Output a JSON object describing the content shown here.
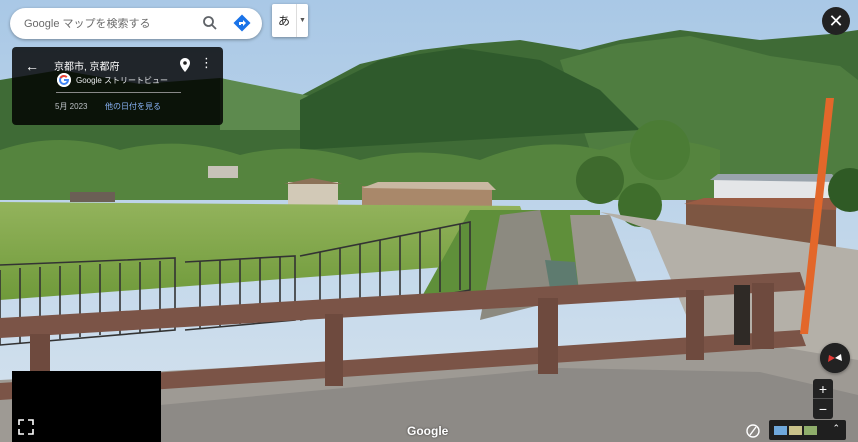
{
  "search": {
    "placeholder": "Google マップを検索する"
  },
  "ime": {
    "label": "あ"
  },
  "close": {
    "label": "✕"
  },
  "info_card": {
    "title": "京都市, 京都府",
    "source": "Google ストリートビュー",
    "date": "5月 2023",
    "other_dates_link": "他の日付を見る"
  },
  "footer": {
    "brand": "Google"
  },
  "zoom": {
    "in": "+",
    "out": "−"
  },
  "layers_toggle": "⌃",
  "icons": [
    "search-icon",
    "directions-icon",
    "back-arrow-icon",
    "pin-icon",
    "more-icon",
    "fullscreen-icon",
    "compass-icon",
    "pegman-icon"
  ]
}
